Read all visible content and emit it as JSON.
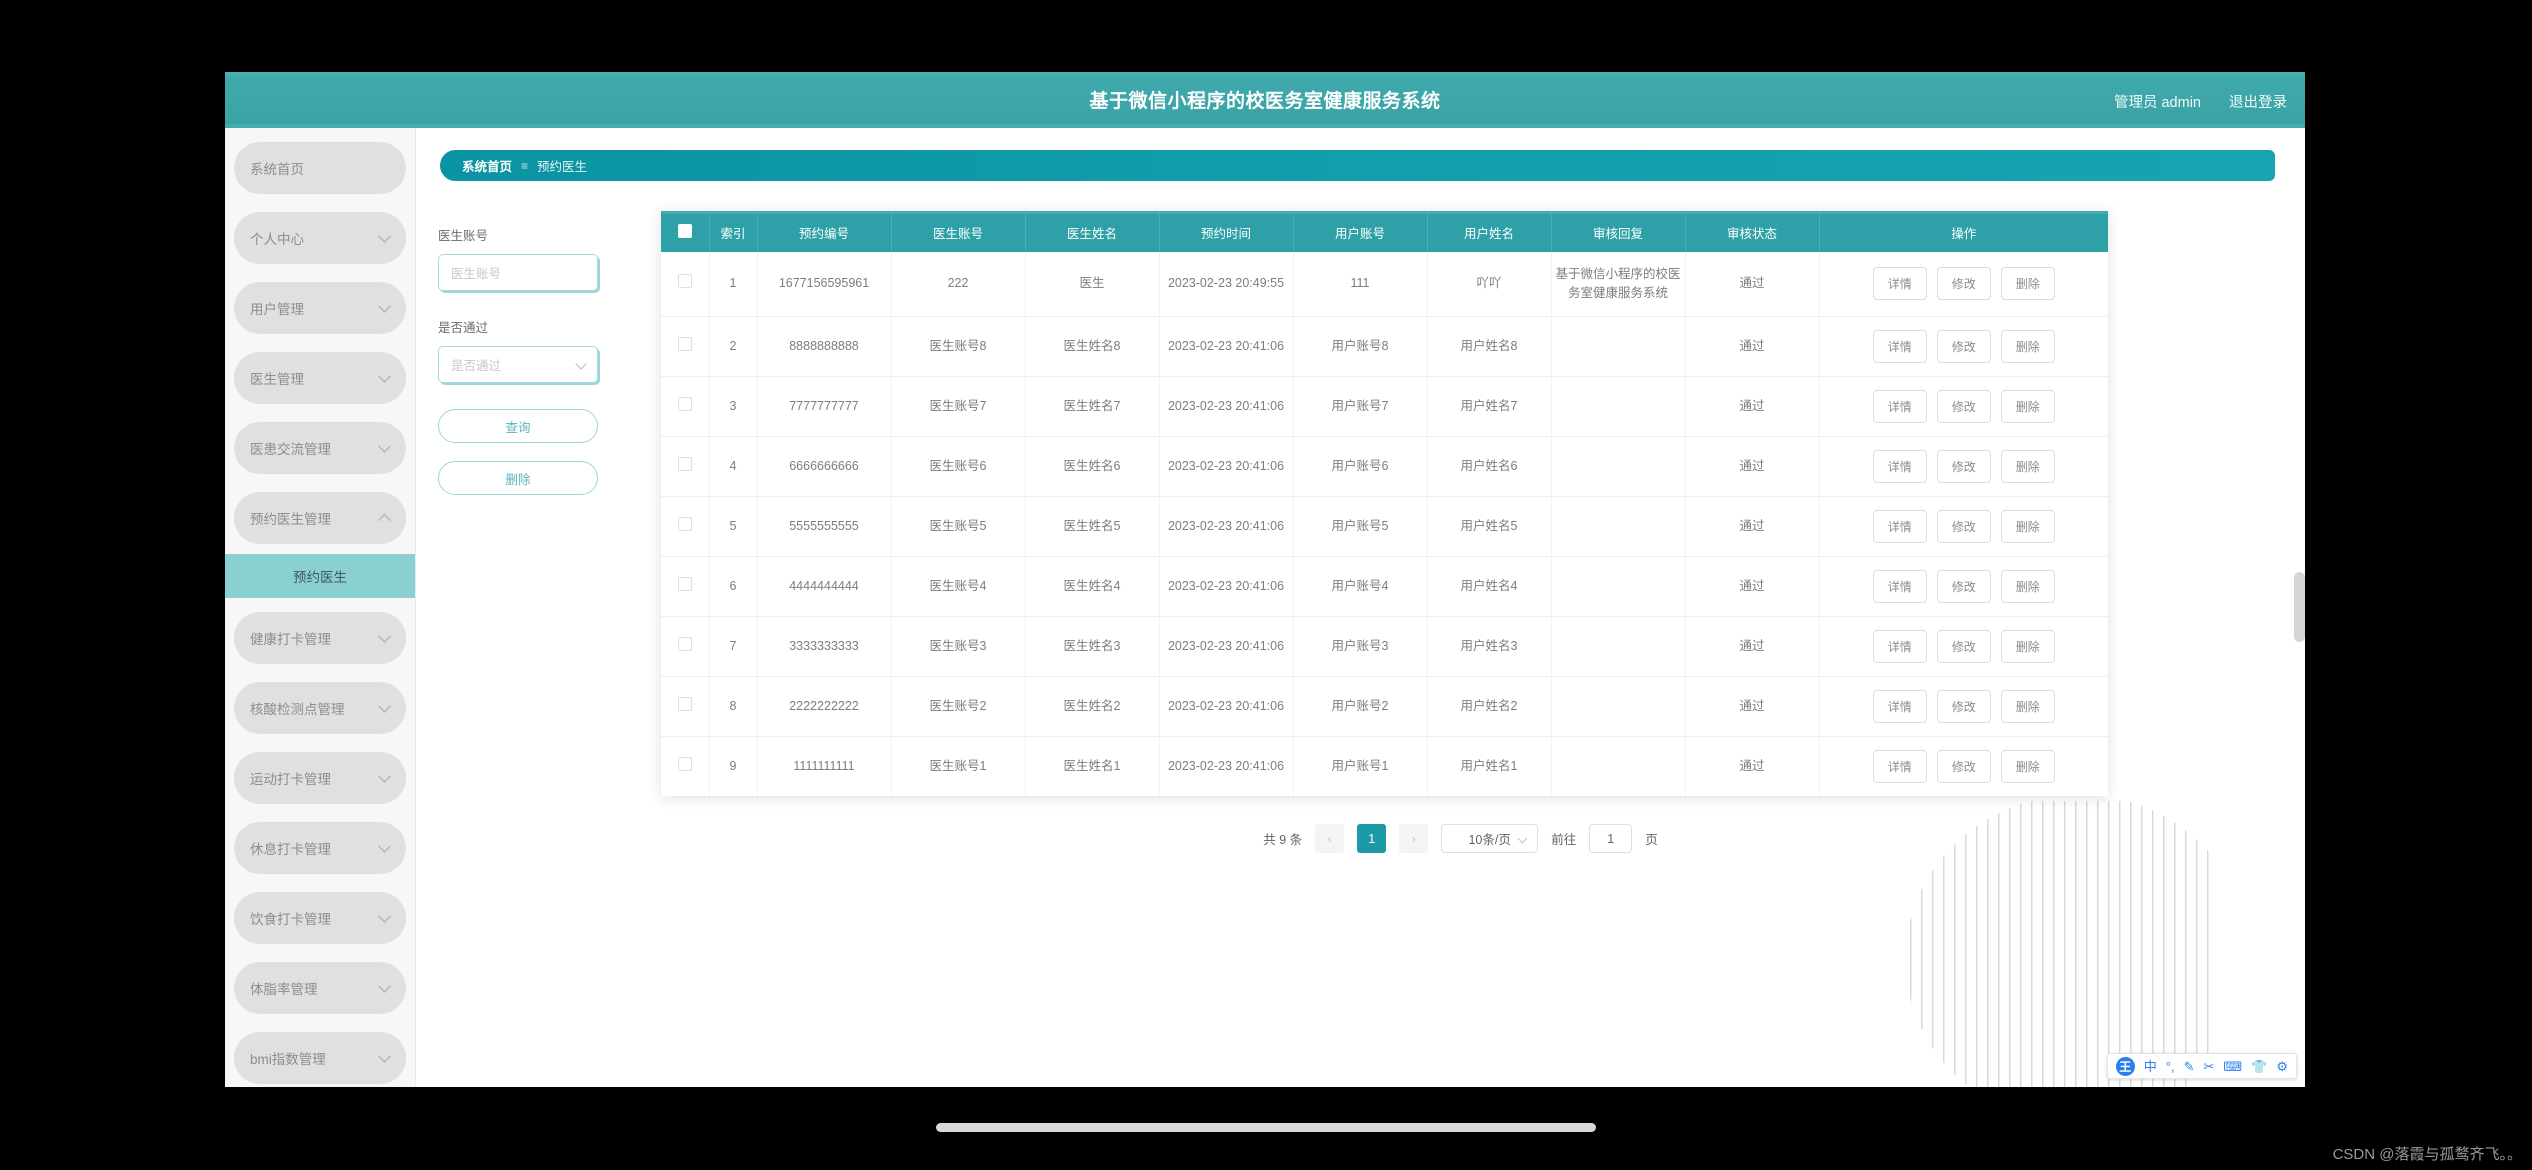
{
  "header": {
    "title": "基于微信小程序的校医务室健康服务系统",
    "user": "管理员 admin",
    "logout": "退出登录"
  },
  "sidebar": {
    "items": [
      {
        "label": "系统首页",
        "expandable": false
      },
      {
        "label": "个人中心",
        "expandable": true
      },
      {
        "label": "用户管理",
        "expandable": true
      },
      {
        "label": "医生管理",
        "expandable": true
      },
      {
        "label": "医患交流管理",
        "expandable": true
      },
      {
        "label": "预约医生管理",
        "expandable": true,
        "open": true
      },
      {
        "label": "健康打卡管理",
        "expandable": true
      },
      {
        "label": "核酸检测点管理",
        "expandable": true
      },
      {
        "label": "运动打卡管理",
        "expandable": true
      },
      {
        "label": "休息打卡管理",
        "expandable": true
      },
      {
        "label": "饮食打卡管理",
        "expandable": true
      },
      {
        "label": "体脂率管理",
        "expandable": true
      },
      {
        "label": "bmi指数管理",
        "expandable": true
      }
    ],
    "active_sub": "预约医生"
  },
  "breadcrumb": {
    "home": "系统首页",
    "separator": "≡",
    "current": "预约医生"
  },
  "filters": {
    "doctor_account_label": "医生账号",
    "doctor_account_placeholder": "医生账号",
    "approved_label": "是否通过",
    "approved_placeholder": "是否通过",
    "search_button": "查询",
    "delete_button": "删除"
  },
  "table": {
    "columns": [
      "",
      "索引",
      "预约编号",
      "医生账号",
      "医生姓名",
      "预约时间",
      "用户账号",
      "用户姓名",
      "审核回复",
      "审核状态",
      "操作"
    ],
    "actions": [
      "详情",
      "修改",
      "删除"
    ],
    "rows": [
      {
        "index": "1",
        "order_no": "1677156595961",
        "doctor_account": "222",
        "doctor_name": "医生",
        "time": "2023-02-23 20:49:55",
        "user_account": "111",
        "user_name": "吖吖",
        "review_reply": "基于微信小程序的校医务室健康服务系统",
        "status": "通过"
      },
      {
        "index": "2",
        "order_no": "8888888888",
        "doctor_account": "医生账号8",
        "doctor_name": "医生姓名8",
        "time": "2023-02-23 20:41:06",
        "user_account": "用户账号8",
        "user_name": "用户姓名8",
        "review_reply": "",
        "status": "通过"
      },
      {
        "index": "3",
        "order_no": "7777777777",
        "doctor_account": "医生账号7",
        "doctor_name": "医生姓名7",
        "time": "2023-02-23 20:41:06",
        "user_account": "用户账号7",
        "user_name": "用户姓名7",
        "review_reply": "",
        "status": "通过"
      },
      {
        "index": "4",
        "order_no": "6666666666",
        "doctor_account": "医生账号6",
        "doctor_name": "医生姓名6",
        "time": "2023-02-23 20:41:06",
        "user_account": "用户账号6",
        "user_name": "用户姓名6",
        "review_reply": "",
        "status": "通过"
      },
      {
        "index": "5",
        "order_no": "5555555555",
        "doctor_account": "医生账号5",
        "doctor_name": "医生姓名5",
        "time": "2023-02-23 20:41:06",
        "user_account": "用户账号5",
        "user_name": "用户姓名5",
        "review_reply": "",
        "status": "通过"
      },
      {
        "index": "6",
        "order_no": "4444444444",
        "doctor_account": "医生账号4",
        "doctor_name": "医生姓名4",
        "time": "2023-02-23 20:41:06",
        "user_account": "用户账号4",
        "user_name": "用户姓名4",
        "review_reply": "",
        "status": "通过"
      },
      {
        "index": "7",
        "order_no": "3333333333",
        "doctor_account": "医生账号3",
        "doctor_name": "医生姓名3",
        "time": "2023-02-23 20:41:06",
        "user_account": "用户账号3",
        "user_name": "用户姓名3",
        "review_reply": "",
        "status": "通过"
      },
      {
        "index": "8",
        "order_no": "2222222222",
        "doctor_account": "医生账号2",
        "doctor_name": "医生姓名2",
        "time": "2023-02-23 20:41:06",
        "user_account": "用户账号2",
        "user_name": "用户姓名2",
        "review_reply": "",
        "status": "通过"
      },
      {
        "index": "9",
        "order_no": "1111111111",
        "doctor_account": "医生账号1",
        "doctor_name": "医生姓名1",
        "time": "2023-02-23 20:41:06",
        "user_account": "用户账号1",
        "user_name": "用户姓名1",
        "review_reply": "",
        "status": "通过"
      }
    ]
  },
  "pagination": {
    "total": "共 9 条",
    "prev": "‹",
    "current_page": "1",
    "next": "›",
    "page_size": "10条/页",
    "jump_label": "前往",
    "jump_value": "1",
    "jump_unit": "页"
  },
  "ime": {
    "logo": "王",
    "icons": [
      "中",
      "°,",
      "✎",
      "✂",
      "⌨",
      "👕",
      "⚙"
    ]
  },
  "watermark": "CSDN @落霞与孤鹜齐飞。。",
  "colors": {
    "accent": "#2da0a8",
    "header": "#3fa9ab",
    "breadcrumb": "#13a0ad",
    "active_sub": "#8ad0d3"
  }
}
